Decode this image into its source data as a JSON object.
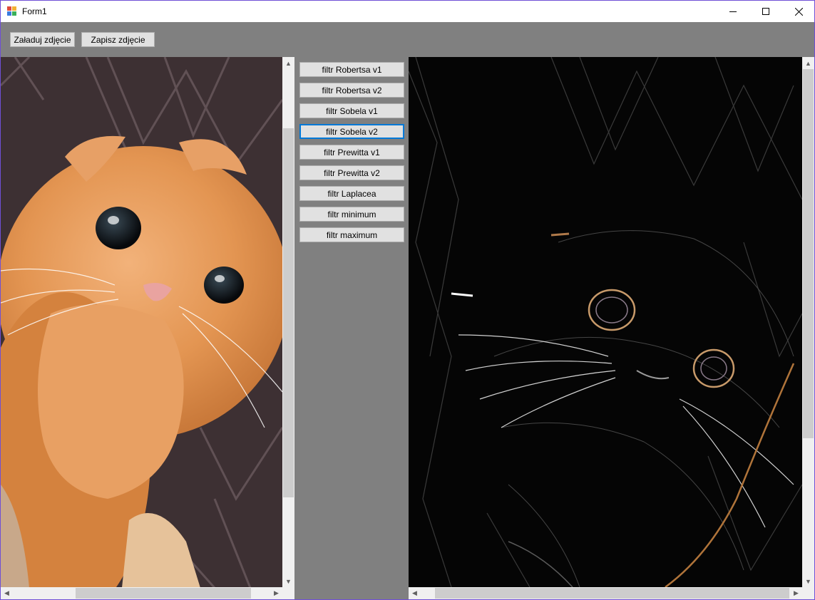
{
  "window": {
    "title": "Form1",
    "icon": "winforms-app-icon",
    "controls": {
      "minimize": "minimize-icon",
      "maximize": "maximize-icon",
      "close": "close-icon"
    }
  },
  "toolbar": {
    "load_label": "Załaduj zdjęcie",
    "save_label": "Zapisz zdjęcie"
  },
  "filters": [
    {
      "label": "filtr Robertsa v1",
      "focused": false
    },
    {
      "label": "filtr Robertsa v2",
      "focused": false
    },
    {
      "label": "filtr Sobela v1",
      "focused": false
    },
    {
      "label": "filtr Sobela v2",
      "focused": true
    },
    {
      "label": "filtr Prewitta v1",
      "focused": false
    },
    {
      "label": "filtr Prewitta v2",
      "focused": false
    },
    {
      "label": "filtr Laplacea",
      "focused": false
    },
    {
      "label": "filtr minimum",
      "focused": false
    },
    {
      "label": "filtr maximum",
      "focused": false
    }
  ],
  "panels": {
    "original": {
      "content": "orange kitten photo"
    },
    "processed": {
      "content": "edge-detected kitten photo"
    }
  },
  "colors": {
    "window_border": "#6f4fd6",
    "client_bg": "#808080",
    "button_bg": "#e1e1e1",
    "focus_border": "#0078d7"
  }
}
